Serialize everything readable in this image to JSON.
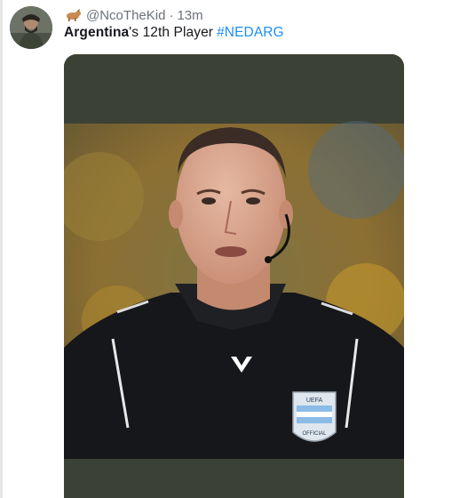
{
  "tweet": {
    "handle": "@NcoTheKid",
    "separator": "·",
    "time": "13m",
    "text_bold": "Argentina",
    "text_rest": "'s 12th Player",
    "hashtag": "#NEDARG"
  },
  "icons": {
    "handle_emoji": "goat-icon",
    "media_logo": "macron-logo-icon",
    "badge": "uefa-referee-badge-icon"
  },
  "badge": {
    "top_text": "UEFA",
    "bottom_text": "OFFICIAL"
  },
  "colors": {
    "hashtag": "#1d8ff0",
    "text": "#16181c",
    "muted": "#6b7177",
    "media_band": "#3c4136"
  }
}
